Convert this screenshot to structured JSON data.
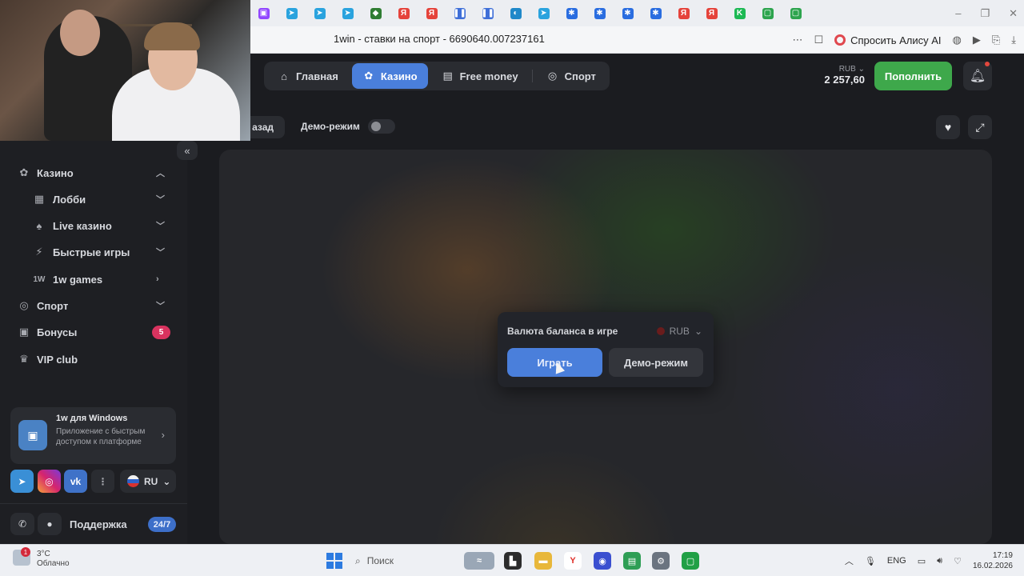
{
  "browser": {
    "page_title": "1win - ставки на спорт - 6690640.007237161",
    "alice_label": "Спросить Алису AI",
    "tabs_favicons": [
      {
        "icon": "twitch-icon",
        "color": "#9146ff",
        "glyph": "▣"
      },
      {
        "icon": "telegram-icon",
        "color": "#2aa3de",
        "glyph": "➤"
      },
      {
        "icon": "telegram-icon",
        "color": "#2aa3de",
        "glyph": "➤"
      },
      {
        "icon": "telegram-icon",
        "color": "#2aa3de",
        "glyph": "➤"
      },
      {
        "icon": "green-app-icon",
        "color": "#2f7d32",
        "glyph": "◆"
      },
      {
        "icon": "yandex-icon",
        "color": "#e5433b",
        "glyph": "Я"
      },
      {
        "icon": "yandex-icon",
        "color": "#e5433b",
        "glyph": "Я"
      },
      {
        "icon": "pause-icon",
        "color": "#3f6fd8",
        "glyph": "❚❚"
      },
      {
        "icon": "pause-icon",
        "color": "#3f6fd8",
        "glyph": "❚❚"
      },
      {
        "icon": "edge-icon",
        "color": "#1f88c9",
        "glyph": "◐"
      },
      {
        "icon": "telegram-icon",
        "color": "#2aa3de",
        "glyph": "➤"
      },
      {
        "icon": "snowflake-icon",
        "color": "#2a6de0",
        "glyph": "✱"
      },
      {
        "icon": "snowflake-icon",
        "color": "#2a6de0",
        "glyph": "✱"
      },
      {
        "icon": "snowflake-icon",
        "color": "#2a6de0",
        "glyph": "✱"
      },
      {
        "icon": "snowflake-icon",
        "color": "#2a6de0",
        "glyph": "✱"
      },
      {
        "icon": "yandex-icon",
        "color": "#e5433b",
        "glyph": "Я"
      },
      {
        "icon": "yandex-icon",
        "color": "#e5433b",
        "glyph": "Я"
      },
      {
        "icon": "kick-icon",
        "color": "#1db954",
        "glyph": "K"
      },
      {
        "icon": "chat-app-icon",
        "color": "#2da44e",
        "glyph": "▢"
      },
      {
        "icon": "chat-app-icon",
        "color": "#2da44e",
        "glyph": "▢"
      }
    ]
  },
  "nav": {
    "items": [
      {
        "label": "Главная",
        "icon": "home-icon",
        "glyph": "⌂"
      },
      {
        "label": "Казино",
        "icon": "casino-chip-icon",
        "glyph": "✿"
      },
      {
        "label": "Free money",
        "icon": "money-icon",
        "glyph": "▤"
      },
      {
        "label": "Спорт",
        "icon": "ball-icon",
        "glyph": "◎"
      }
    ]
  },
  "account": {
    "currency": "RUB",
    "balance": "2 257,60",
    "deposit_label": "Пополнить"
  },
  "game_bar": {
    "back_label": "Назад",
    "back_visible": "азад",
    "demo_label": "Демо-режим"
  },
  "modal": {
    "label": "Валюта баланса в игре",
    "currency": "RUB",
    "play_label": "Играть",
    "demo_label": "Демо-режим"
  },
  "sidebar": {
    "casino": "Казино",
    "lobby": "Лобби",
    "live": "Live казино",
    "fast": "Быстрые игры",
    "onew_prefix": "1W",
    "onew": "1w games",
    "sport": "Спорт",
    "bonuses": "Бонусы",
    "bonus_count": "5",
    "vip": "VIP club",
    "app_title": "1w для Windows",
    "app_desc": "Приложение с быстрым доступом к платформе",
    "lang": "RU",
    "support": "Поддержка",
    "support_badge": "24/7"
  },
  "taskbar": {
    "temp": "3°C",
    "weather": "Облачно",
    "weather_alert": "1",
    "search": "Поиск",
    "lang": "ENG",
    "time": "17:19",
    "date": "16.02.2026"
  },
  "colors": {
    "accent": "#4a7fdb",
    "deposit": "#3ea84b",
    "badge": "#d9335f"
  }
}
